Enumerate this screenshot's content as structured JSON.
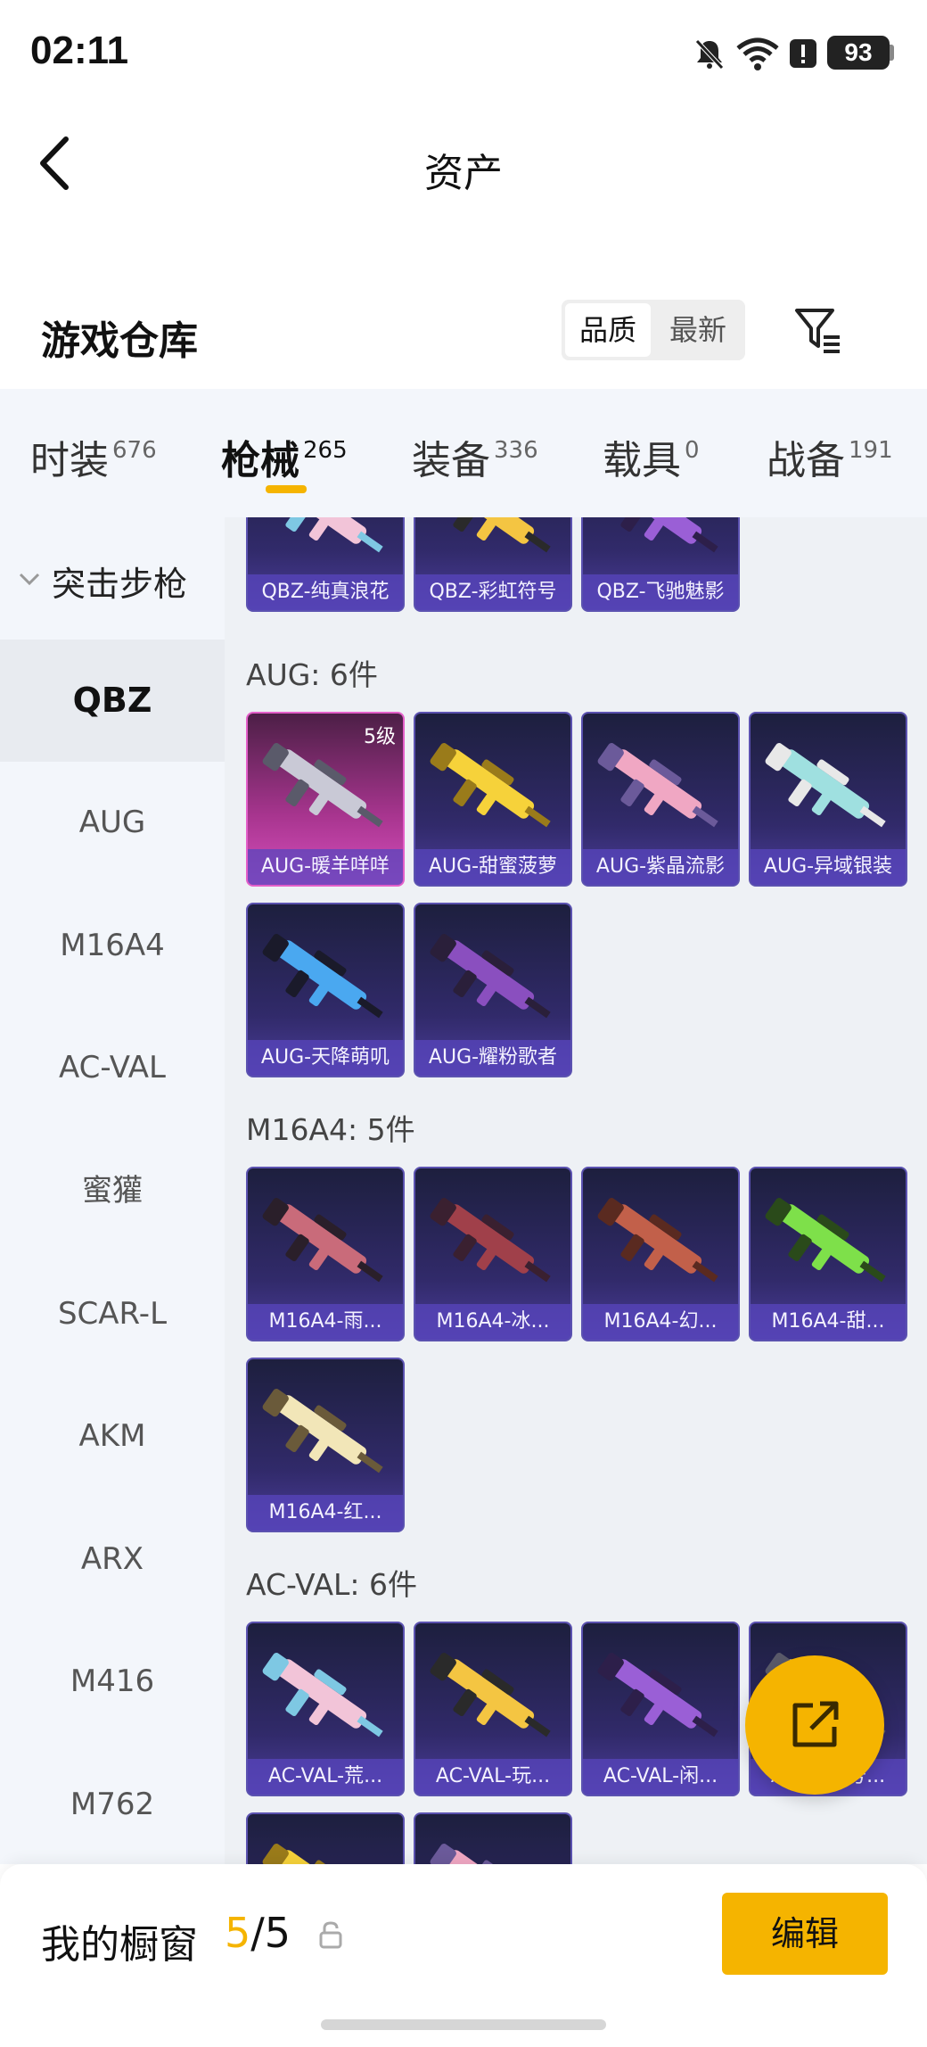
{
  "status_bar": {
    "time": "02:11",
    "battery": "93",
    "icons": [
      "bell-off-icon",
      "wifi-icon",
      "alert-icon",
      "battery-icon"
    ]
  },
  "nav": {
    "title": "资产",
    "back_icon": "chevron-left-icon"
  },
  "header": {
    "section_title": "游戏仓库",
    "sort_options": [
      "品质",
      "最新"
    ],
    "sort_selected": "品质",
    "filter_icon": "filter-icon"
  },
  "tabs": [
    {
      "label": "时装",
      "count": "676"
    },
    {
      "label": "枪械",
      "count": "265",
      "active": true
    },
    {
      "label": "装备",
      "count": "336"
    },
    {
      "label": "载具",
      "count": "0"
    },
    {
      "label": "战备",
      "count": "191"
    }
  ],
  "sidebar": {
    "category": "突击步枪",
    "items": [
      "QBZ",
      "AUG",
      "M16A4",
      "AC-VAL",
      "蜜獾",
      "SCAR-L",
      "AKM",
      "ARX",
      "M416",
      "M762"
    ],
    "active": "QBZ"
  },
  "groups": [
    {
      "title": "",
      "items": [
        {
          "label": "QBZ-纯真浪花"
        },
        {
          "label": "QBZ-彩虹符号"
        },
        {
          "label": "QBZ-飞驰魅影"
        }
      ]
    },
    {
      "title": "AUG: 6件",
      "items": [
        {
          "label": "AUG-暖羊咩咩",
          "badge": "5级",
          "rarity": "legendary"
        },
        {
          "label": "AUG-甜蜜菠萝"
        },
        {
          "label": "AUG-紫晶流影"
        },
        {
          "label": "AUG-异域银装"
        },
        {
          "label": "AUG-天降萌叽"
        },
        {
          "label": "AUG-耀粉歌者"
        }
      ]
    },
    {
      "title": "M16A4: 5件",
      "items": [
        {
          "label": "M16A4-雨..."
        },
        {
          "label": "M16A4-冰..."
        },
        {
          "label": "M16A4-幻..."
        },
        {
          "label": "M16A4-甜..."
        },
        {
          "label": "M16A4-红..."
        }
      ]
    },
    {
      "title": "AC-VAL: 6件",
      "items": [
        {
          "label": "AC-VAL-荒..."
        },
        {
          "label": "AC-VAL-玩..."
        },
        {
          "label": "AC-VAL-闲..."
        },
        {
          "label": "AC-VAL-号..."
        },
        {
          "label": ""
        },
        {
          "label": ""
        }
      ]
    }
  ],
  "fab": {
    "icon": "share-icon"
  },
  "bottom_bar": {
    "label": "我的橱窗",
    "count_current": "5",
    "count_total": "/5",
    "lock_icon": "lock-icon",
    "edit_label": "编辑"
  },
  "colors": {
    "accent": "#f5b400",
    "card_bg": "#2f2a68",
    "legendary": "#d74fbd",
    "sidebar_bg": "#f3f6fb"
  }
}
